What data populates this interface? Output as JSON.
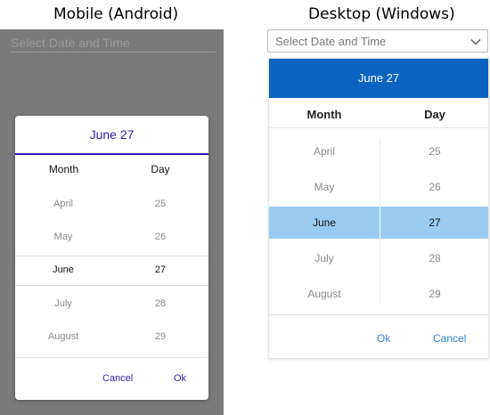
{
  "headings": {
    "mobile": "Mobile (Android)",
    "desktop": "Desktop (Windows)"
  },
  "mobile": {
    "placeholder": "Select Date and Time",
    "dialog": {
      "header": "June 27",
      "columns": {
        "month": "Month",
        "day": "Day"
      },
      "months": [
        "April",
        "May",
        "June",
        "July",
        "August"
      ],
      "days": [
        "25",
        "26",
        "27",
        "28",
        "29"
      ],
      "selected_index": 2,
      "cancel": "Cancel",
      "ok": "Ok"
    },
    "colors": {
      "accent": "#2e1cb2",
      "overlay": "#7a7a7a"
    }
  },
  "desktop": {
    "placeholder": "Select Date and Time",
    "dropdown_icon": "chevron-down-icon",
    "dropdown": {
      "header": "June 27",
      "columns": {
        "month": "Month",
        "day": "Day"
      },
      "months": [
        "April",
        "May",
        "June",
        "July",
        "August"
      ],
      "days": [
        "25",
        "26",
        "27",
        "28",
        "29"
      ],
      "selected_index": 2,
      "ok": "Ok",
      "cancel": "Cancel"
    },
    "colors": {
      "header_bg": "#0c64c0",
      "selection_bg": "#9ccbf0",
      "button_text": "#2d86d9"
    }
  }
}
